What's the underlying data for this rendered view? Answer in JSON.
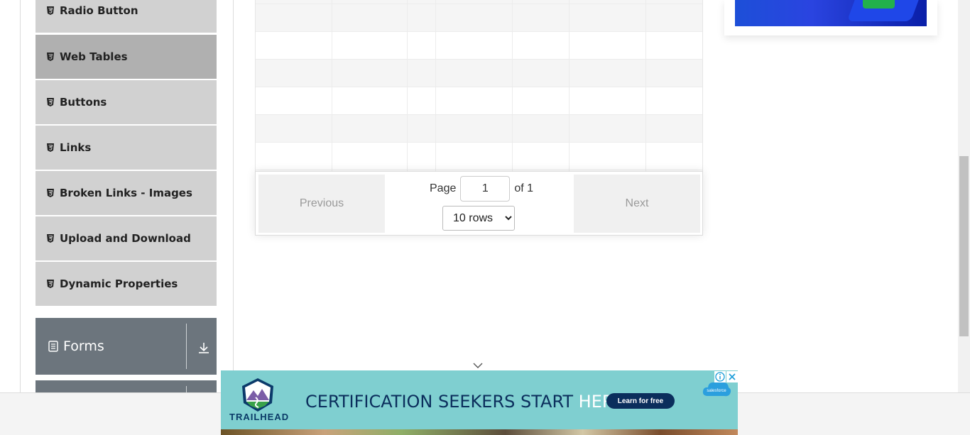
{
  "sidebar": {
    "items": [
      {
        "label": "Radio Button",
        "icon": "html5-icon"
      },
      {
        "label": "Web Tables",
        "icon": "html5-icon"
      },
      {
        "label": "Buttons",
        "icon": "html5-icon"
      },
      {
        "label": "Links",
        "icon": "html5-icon"
      },
      {
        "label": "Broken Links - Images",
        "icon": "html5-icon"
      },
      {
        "label": "Upload and Download",
        "icon": "html5-icon"
      },
      {
        "label": "Dynamic Properties",
        "icon": "html5-icon"
      }
    ],
    "active_item": "Web Tables",
    "groups": [
      {
        "label": "Forms",
        "icon": "form-icon",
        "toggle_icon": "download-arrow-icon"
      }
    ]
  },
  "pagination": {
    "previous_label": "Previous",
    "next_label": "Next",
    "page_label": "Page",
    "page_value": "1",
    "of_label": "of 1",
    "rows_options": [
      "10 rows"
    ],
    "rows_selected": "10 rows"
  },
  "bottom_ad": {
    "brand": "TRAILHEAD",
    "headline_main": "CERTIFICATION SEEKERS START ",
    "headline_highlight": "HERE.",
    "cta": "Learn for free",
    "sponsor": "salesforce"
  },
  "colors": {
    "menu_bg": "#d1d1d1",
    "menu_active_bg": "#b0b0b0",
    "group_header_bg": "#6c757d",
    "ad_bg": "#7fcfd0",
    "ad_dark": "#0b2e5c"
  }
}
